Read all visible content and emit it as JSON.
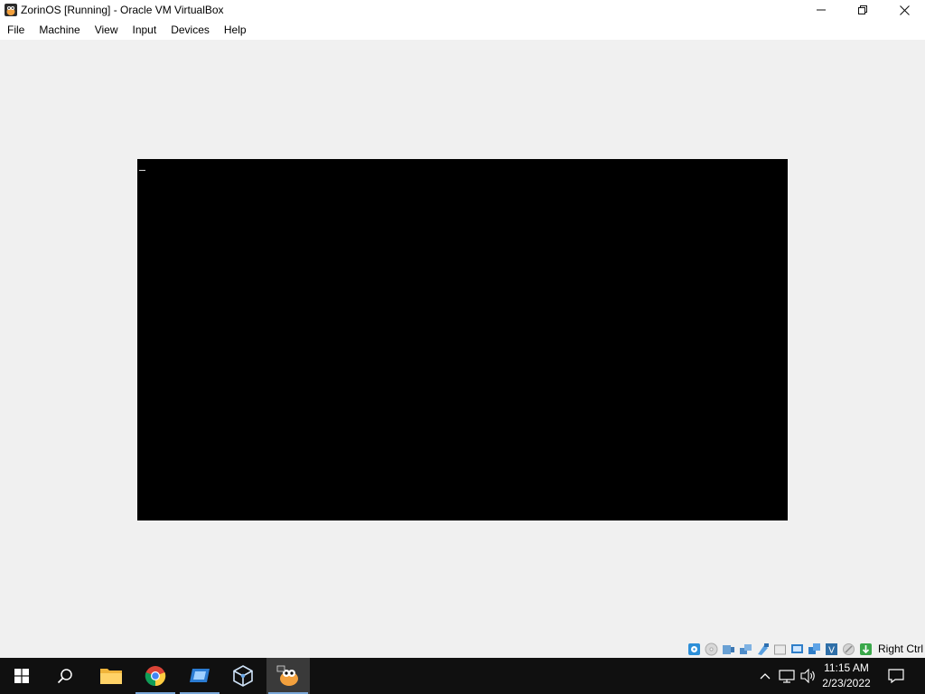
{
  "window": {
    "title": "ZorinOS [Running] - Oracle VM VirtualBox",
    "controls": {
      "minimize": "—",
      "restore": "❐",
      "close": "✕"
    }
  },
  "menubar": {
    "items": [
      "File",
      "Machine",
      "View",
      "Input",
      "Devices",
      "Help"
    ]
  },
  "statusbar": {
    "icons": [
      "hard-disk-icon",
      "optical-drive-icon",
      "audio-icon",
      "network-icon",
      "usb-icon",
      "shared-folders-icon",
      "display-icon",
      "recording-icon",
      "cpu-icon",
      "mouse-integration-icon",
      "keyboard-capture-icon"
    ],
    "host_key": "Right Ctrl"
  },
  "taskbar": {
    "apps": [
      "start-button",
      "search-button",
      "file-explorer",
      "google-chrome",
      "virtualbox-manager-app",
      "virtualbox-app",
      "zorinos-vm-app"
    ],
    "clock": {
      "time": "11:15 AM",
      "date": "2/23/2022"
    }
  },
  "colors": {
    "vm_screen": "#000000",
    "taskbar": "#101010",
    "active_underline": "#7aa7d8"
  }
}
